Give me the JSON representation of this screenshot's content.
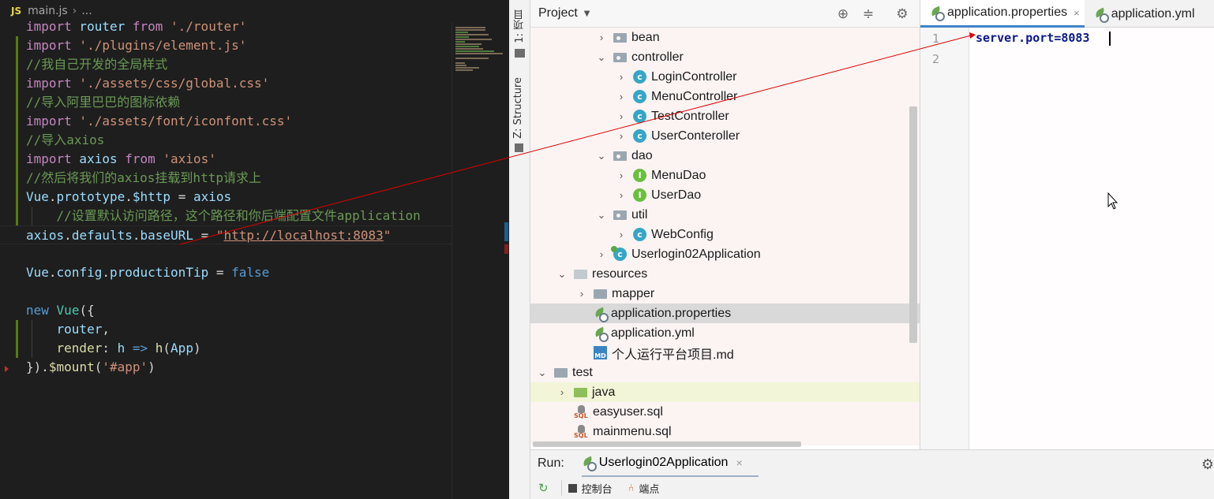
{
  "vscode": {
    "breadcrumb": {
      "lang": "JS",
      "file": "main.js",
      "sep": "›",
      "rest": "..."
    },
    "lines": [
      {
        "tokens": [
          {
            "t": "import",
            "c": "k"
          },
          {
            "t": " router ",
            "c": "v"
          },
          {
            "t": "from",
            "c": "k"
          },
          {
            "t": " './router'",
            "c": "s"
          }
        ]
      },
      {
        "tokens": [
          {
            "t": "import",
            "c": "k"
          },
          {
            "t": " './plugins/element.js'",
            "c": "s"
          }
        ]
      },
      {
        "tokens": [
          {
            "t": "//我自己开发的全局样式",
            "c": "c"
          }
        ]
      },
      {
        "tokens": [
          {
            "t": "import",
            "c": "k"
          },
          {
            "t": " './assets/css/global.css'",
            "c": "s"
          }
        ]
      },
      {
        "tokens": [
          {
            "t": "//导入阿里巴巴的图标依赖",
            "c": "c"
          }
        ]
      },
      {
        "tokens": [
          {
            "t": "import",
            "c": "k"
          },
          {
            "t": " './assets/font/iconfont.css'",
            "c": "s"
          }
        ]
      },
      {
        "tokens": [
          {
            "t": "//导入axios",
            "c": "c"
          }
        ]
      },
      {
        "tokens": [
          {
            "t": "import",
            "c": "k"
          },
          {
            "t": " axios ",
            "c": "v"
          },
          {
            "t": "from",
            "c": "k"
          },
          {
            "t": " 'axios'",
            "c": "s"
          }
        ]
      },
      {
        "tokens": [
          {
            "t": "//然后将我们的axios挂载到http请求上",
            "c": "c"
          }
        ]
      },
      {
        "tokens": [
          {
            "t": "Vue",
            "c": "v"
          },
          {
            "t": ".",
            "c": "p"
          },
          {
            "t": "prototype",
            "c": "v"
          },
          {
            "t": ".",
            "c": "p"
          },
          {
            "t": "$http",
            "c": "v"
          },
          {
            "t": " = ",
            "c": "p"
          },
          {
            "t": "axios",
            "c": "v"
          }
        ]
      },
      {
        "tokens": [
          {
            "t": "    //设置默认访问路径，这个路径和你后端配置文件application",
            "c": "c"
          }
        ]
      },
      {
        "tokens": [
          {
            "t": "axios",
            "c": "v"
          },
          {
            "t": ".",
            "c": "p"
          },
          {
            "t": "defaults",
            "c": "v"
          },
          {
            "t": ".",
            "c": "p"
          },
          {
            "t": "baseURL",
            "c": "v"
          },
          {
            "t": " = ",
            "c": "p"
          },
          {
            "t": "\"",
            "c": "s"
          },
          {
            "t": "http://localhost:8083",
            "c": "s u"
          },
          {
            "t": "\"",
            "c": "s"
          }
        ]
      },
      {
        "tokens": []
      },
      {
        "tokens": [
          {
            "t": "Vue",
            "c": "v"
          },
          {
            "t": ".",
            "c": "p"
          },
          {
            "t": "config",
            "c": "v"
          },
          {
            "t": ".",
            "c": "p"
          },
          {
            "t": "productionTip",
            "c": "v"
          },
          {
            "t": " = ",
            "c": "p"
          },
          {
            "t": "false",
            "c": "b"
          }
        ]
      },
      {
        "tokens": []
      },
      {
        "tokens": [
          {
            "t": "new",
            "c": "kw"
          },
          {
            "t": " ",
            "c": "p"
          },
          {
            "t": "Vue",
            "c": "cls"
          },
          {
            "t": "({",
            "c": "p"
          }
        ]
      },
      {
        "tokens": [
          {
            "t": "    router",
            "c": "v"
          },
          {
            "t": ",",
            "c": "p"
          }
        ]
      },
      {
        "tokens": [
          {
            "t": "    render",
            "c": "f"
          },
          {
            "t": ": ",
            "c": "p"
          },
          {
            "t": "h",
            "c": "v"
          },
          {
            "t": " => ",
            "c": "kw"
          },
          {
            "t": "h",
            "c": "f"
          },
          {
            "t": "(",
            "c": "p"
          },
          {
            "t": "App",
            "c": "v"
          },
          {
            "t": ")",
            "c": "p"
          }
        ]
      },
      {
        "tokens": [
          {
            "t": "})",
            "c": "p"
          },
          {
            "t": ".",
            "c": "p"
          },
          {
            "t": "$mount",
            "c": "f"
          },
          {
            "t": "(",
            "c": "p"
          },
          {
            "t": "'#app'",
            "c": "s"
          },
          {
            "t": ")",
            "c": "p"
          }
        ]
      }
    ]
  },
  "ide": {
    "toolstrip": {
      "project_tab": "1: 项目",
      "structure_tab": "Z: Structure"
    },
    "project_panel": {
      "title": "Project",
      "dropdown": "▼"
    },
    "tree": [
      {
        "label": "bean",
        "depth": 5,
        "icon": "package-folder",
        "arrow": "›",
        "state": ""
      },
      {
        "label": "controller",
        "depth": 5,
        "icon": "package-folder",
        "arrow": "⌄",
        "state": ""
      },
      {
        "label": "LoginController",
        "depth": 6,
        "icon": "class-icon",
        "arrow": "›",
        "state": ""
      },
      {
        "label": "MenuController",
        "depth": 6,
        "icon": "class-icon",
        "arrow": "›",
        "state": ""
      },
      {
        "label": "TestController",
        "depth": 6,
        "icon": "class-icon",
        "arrow": "›",
        "state": ""
      },
      {
        "label": "UserConteroller",
        "depth": 6,
        "icon": "class-icon",
        "arrow": "›",
        "state": ""
      },
      {
        "label": "dao",
        "depth": 5,
        "icon": "package-folder",
        "arrow": "⌄",
        "state": ""
      },
      {
        "label": "MenuDao",
        "depth": 6,
        "icon": "interface-icon",
        "arrow": "›",
        "state": ""
      },
      {
        "label": "UserDao",
        "depth": 6,
        "icon": "interface-icon",
        "arrow": "›",
        "state": ""
      },
      {
        "label": "util",
        "depth": 5,
        "icon": "package-folder",
        "arrow": "⌄",
        "state": ""
      },
      {
        "label": "WebConfig",
        "depth": 6,
        "icon": "class-icon",
        "arrow": "›",
        "state": ""
      },
      {
        "label": "Userlogin02Application",
        "depth": 5,
        "icon": "spring-app-class-icon",
        "arrow": "›",
        "state": ""
      },
      {
        "label": "resources",
        "depth": 3,
        "icon": "resources-folder",
        "arrow": "⌄",
        "state": ""
      },
      {
        "label": "mapper",
        "depth": 4,
        "icon": "folder",
        "arrow": "›",
        "state": ""
      },
      {
        "label": "application.properties",
        "depth": 4,
        "icon": "spring-properties-icon",
        "arrow": "",
        "state": "selected"
      },
      {
        "label": "application.yml",
        "depth": 4,
        "icon": "spring-properties-icon",
        "arrow": "",
        "state": ""
      },
      {
        "label": "个人运行平台项目.md",
        "depth": 4,
        "icon": "markdown-icon",
        "arrow": "",
        "state": ""
      },
      {
        "label": "test",
        "depth": 2,
        "icon": "folder",
        "arrow": "⌄",
        "state": ""
      },
      {
        "label": "java",
        "depth": 3,
        "icon": "test-source-folder",
        "arrow": "›",
        "state": "highlighted"
      },
      {
        "label": "easyuser.sql",
        "depth": 3,
        "icon": "sql-icon",
        "arrow": "",
        "state": ""
      },
      {
        "label": "mainmenu.sql",
        "depth": 3,
        "icon": "sql-icon",
        "arrow": "",
        "state": ""
      }
    ],
    "tabs": [
      {
        "label": "application.properties",
        "close": "×",
        "active": true
      },
      {
        "label": "application.yml",
        "close": "",
        "active": false
      }
    ],
    "editor": {
      "line_numbers": [
        "1",
        "2"
      ],
      "line1_key": "server.port",
      "line1_eq": "=",
      "line1_val": "8083"
    },
    "run": {
      "label": "Run:",
      "config": "Userlogin02Application",
      "close": "×",
      "console": "控制台",
      "breakpoints": "端点"
    }
  },
  "colors": {
    "annotation_arrow": "#e00000",
    "selection": "#d9d9d9",
    "tree_bg": "#fbf4f3"
  }
}
